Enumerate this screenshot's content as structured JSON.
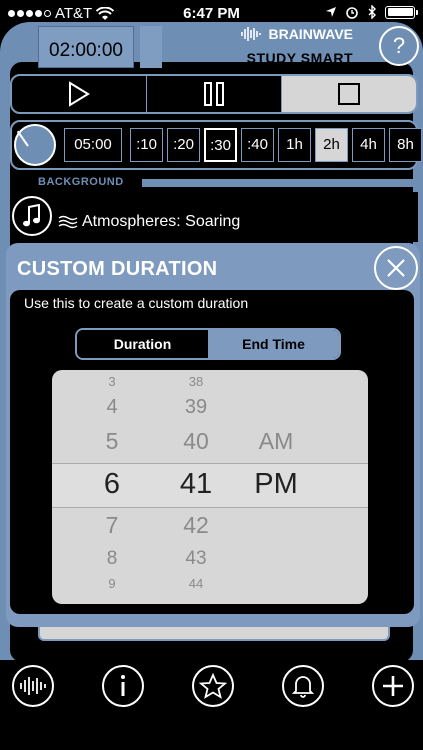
{
  "status_bar": {
    "carrier": "AT&T",
    "time": "6:47 PM"
  },
  "header": {
    "timer": "02:00:00",
    "brand_name": "BRAINWAVE",
    "brand_sub": "STUDY SMART",
    "help_label": "?"
  },
  "durations": {
    "current": "05:00",
    "options": [
      ":10",
      ":20",
      ":30",
      ":40",
      "1h",
      "2h",
      "4h",
      "8h"
    ],
    "selected": ":30"
  },
  "background": {
    "label": "BACKGROUND",
    "track": "Atmospheres: Soaring"
  },
  "modal": {
    "title": "CUSTOM DURATION",
    "description": "Use this to create a custom duration",
    "tabs": [
      "Duration",
      "End Time"
    ],
    "active_tab": "Duration",
    "picker": {
      "hours": [
        "3",
        "4",
        "5",
        "6",
        "7",
        "8",
        "9"
      ],
      "minutes": [
        "38",
        "39",
        "40",
        "41",
        "42",
        "43",
        "44"
      ],
      "ampm": [
        "AM",
        "PM"
      ],
      "selected_hour": "6",
      "selected_minute": "41",
      "selected_ampm": "PM"
    }
  },
  "colors": {
    "accent": "#6e8eb4",
    "modal": "#7e9bbf",
    "picker_bg": "#d7d7d7"
  },
  "tabbar": {
    "items": [
      "waveform-icon",
      "info-icon",
      "star-icon",
      "bell-icon",
      "plus-icon"
    ]
  }
}
